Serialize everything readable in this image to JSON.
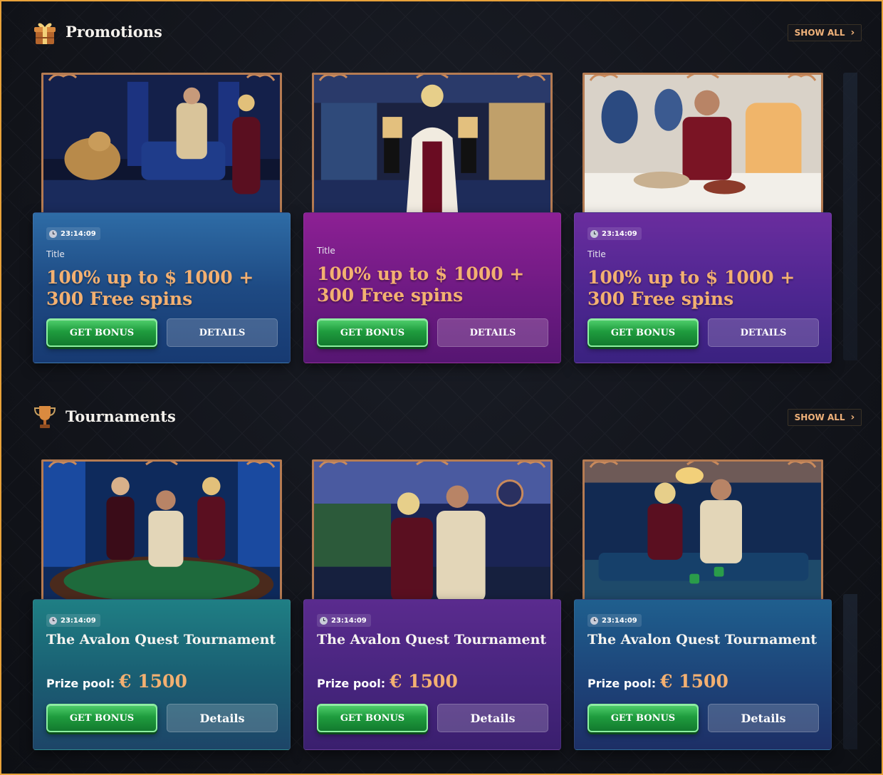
{
  "promotions": {
    "title": "Promotions",
    "show_all": "SHOW ALL",
    "cards": [
      {
        "timer": "23:14:09",
        "label": "Title",
        "offer": "100% up to $ 1000 + 300 Free spins",
        "bonus_label": "GET BONUS",
        "details_label": "DETAILS",
        "theme": "blue"
      },
      {
        "label": "Title",
        "offer": "100% up to $ 1000 + 300 Free spins",
        "bonus_label": "GET BONUS",
        "details_label": "DETAILS",
        "theme": "magenta"
      },
      {
        "timer": "23:14:09",
        "label": "Title",
        "offer": "100% up to $ 1000 + 300 Free spins",
        "bonus_label": "GET BONUS",
        "details_label": "DETAILS",
        "theme": "violet"
      }
    ]
  },
  "tournaments": {
    "title": "Tournaments",
    "show_all": "SHOW ALL",
    "cards": [
      {
        "timer": "23:14:09",
        "name": "The Avalon Quest Tournament",
        "prize_label": "Prize pool:",
        "prize_value": "€ 1500",
        "bonus_label": "GET BONUS",
        "details_label": "Details",
        "theme": "teal"
      },
      {
        "timer": "23:14:09",
        "name": "The Avalon Quest Tournament",
        "prize_label": "Prize pool:",
        "prize_value": "€ 1500",
        "bonus_label": "GET BONUS",
        "details_label": "Details",
        "theme": "purple"
      },
      {
        "timer": "23:14:09",
        "name": "The Avalon Quest Tournament",
        "prize_label": "Prize pool:",
        "prize_value": "€ 1500",
        "bonus_label": "GET BONUS",
        "details_label": "Details",
        "theme": "navy"
      }
    ]
  },
  "icons": {
    "promotions": "gift-box-icon",
    "tournaments": "trophy-icon",
    "show_all": "chevron-right-icon",
    "timer": "clock-icon"
  },
  "colors": {
    "accent": "#f3b071",
    "bonus_button": "#1f9c3e",
    "frame": "#b57b52"
  }
}
